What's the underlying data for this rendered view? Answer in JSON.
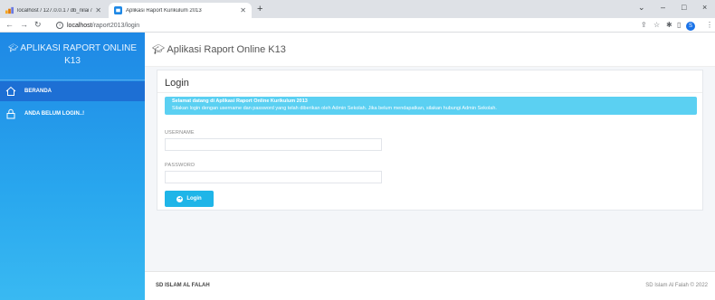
{
  "browser": {
    "tabs": [
      {
        "title": "localhost / 127.0.0.1 / db_nilai / ..."
      },
      {
        "title": "Aplikasi Raport Kurikulum 2013"
      }
    ],
    "new_tab": "+",
    "url_host": "localhost",
    "url_path": "/raport2013/login",
    "window_controls": {
      "minimize": "–",
      "maximize": "□",
      "close": "×"
    },
    "profile_initial": "S"
  },
  "sidebar": {
    "brand": "APLIKASI RAPORT ONLINE K13",
    "items": [
      {
        "label": "BERANDA",
        "icon": "home-icon"
      },
      {
        "label": "ANDA BELUM LOGIN..!",
        "icon": "lock-icon"
      }
    ]
  },
  "header": {
    "title": "Aplikasi Raport Online K13"
  },
  "login": {
    "title": "Login",
    "alert_title": "Selamat datang di Aplikasi Raport Online Kurikulum 2013",
    "alert_text": "Silakan login dengan username dan password yang telah diberikan oleh Admin Sekolah. Jika belum mendapatkan, silakan hubungi Admin Sekolah.",
    "username_label": "USERNAME",
    "username_value": "",
    "password_label": "PASSWORD",
    "password_value": "",
    "button_label": "Login"
  },
  "footer": {
    "left": "SD ISLAM AL FALAH",
    "right": "SD Islam Al Falah © 2022"
  },
  "colors": {
    "sidebar_top": "#1e88e5",
    "sidebar_bottom": "#39b9f2",
    "alert": "#5bd0f2",
    "button": "#1fb5e8"
  }
}
